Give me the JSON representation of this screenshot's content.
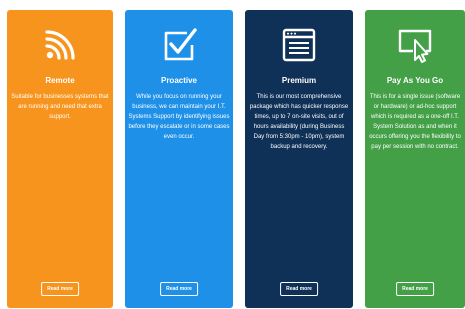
{
  "cards": [
    {
      "icon": "wifi-signal-icon",
      "color": "#f7941d",
      "title": "Remote",
      "description": "Suitable for businesses systems that are running and need that extra support.",
      "button_label": "Read more"
    },
    {
      "icon": "checkbox-check-icon",
      "color": "#1e90e8",
      "title": "Proactive",
      "description": "While you focus on running your business, we can maintain your I.T. Systems Support by identifying issues before they escalate or in some cases even occur.",
      "button_label": "Read more"
    },
    {
      "icon": "browser-window-icon",
      "color": "#0f3057",
      "title": "Premium",
      "description": "This is our most comprehensive package which has quicker response times, up to 7 on-site visits, out of hours availability (during Business Day from 5:30pm - 10pm), system backup and recovery.",
      "button_label": "Read more"
    },
    {
      "icon": "cursor-click-icon",
      "color": "#43a047",
      "title": "Pay As You Go",
      "description": "This is for a single issue (software or hardware) or ad-hoc support which is required as a one-off I.T. System Solution as and when it occurs offering you the flexibility to pay per session with no contract.",
      "button_label": "Read more"
    }
  ]
}
